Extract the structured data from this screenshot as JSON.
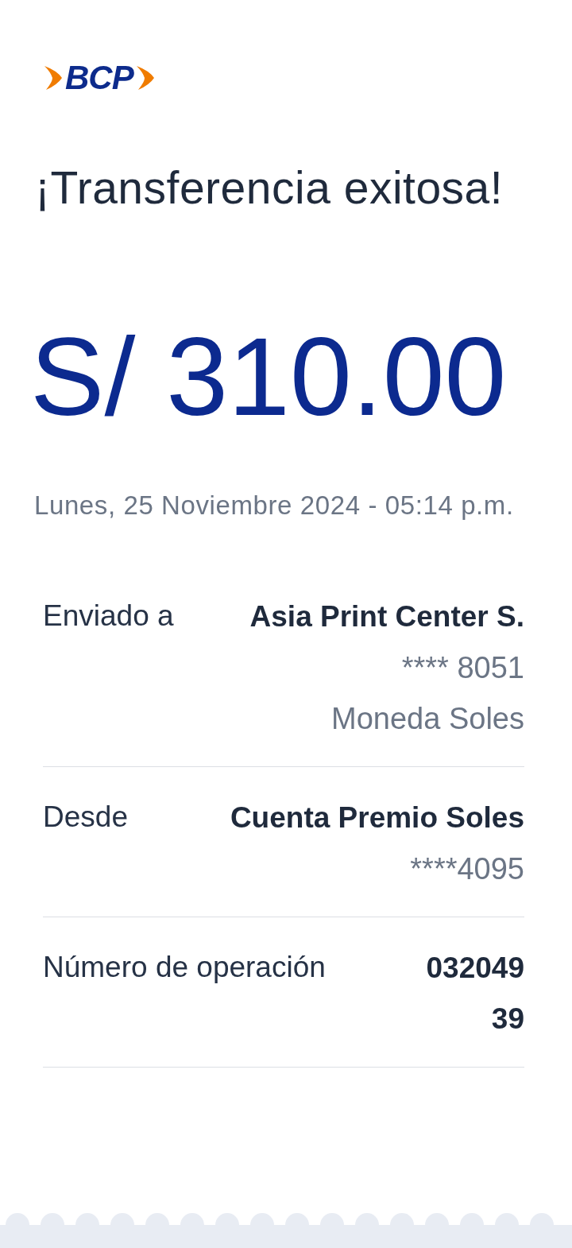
{
  "logo": {
    "text": "BCP"
  },
  "title": "¡Transferencia exitosa!",
  "amount": "S/ 310.00",
  "date": "Lunes, 25 Noviembre 2024 - 05:14 p.m.",
  "details": [
    {
      "label": "Enviado a",
      "kind": "normal",
      "lines": [
        {
          "text": "Asia Print Center S.",
          "kind": "primary"
        },
        {
          "text": "**** 8051",
          "kind": "secondary"
        },
        {
          "text": "Moneda Soles",
          "kind": "secondary"
        }
      ]
    },
    {
      "label": "Desde",
      "kind": "normal",
      "lines": [
        {
          "text": "Cuenta Premio Soles",
          "kind": "primary"
        },
        {
          "text": "****4095",
          "kind": "secondary"
        }
      ]
    },
    {
      "label": "Número de operación",
      "kind": "narrow",
      "lines": [
        {
          "text": "03204939",
          "kind": "primary"
        }
      ]
    }
  ]
}
